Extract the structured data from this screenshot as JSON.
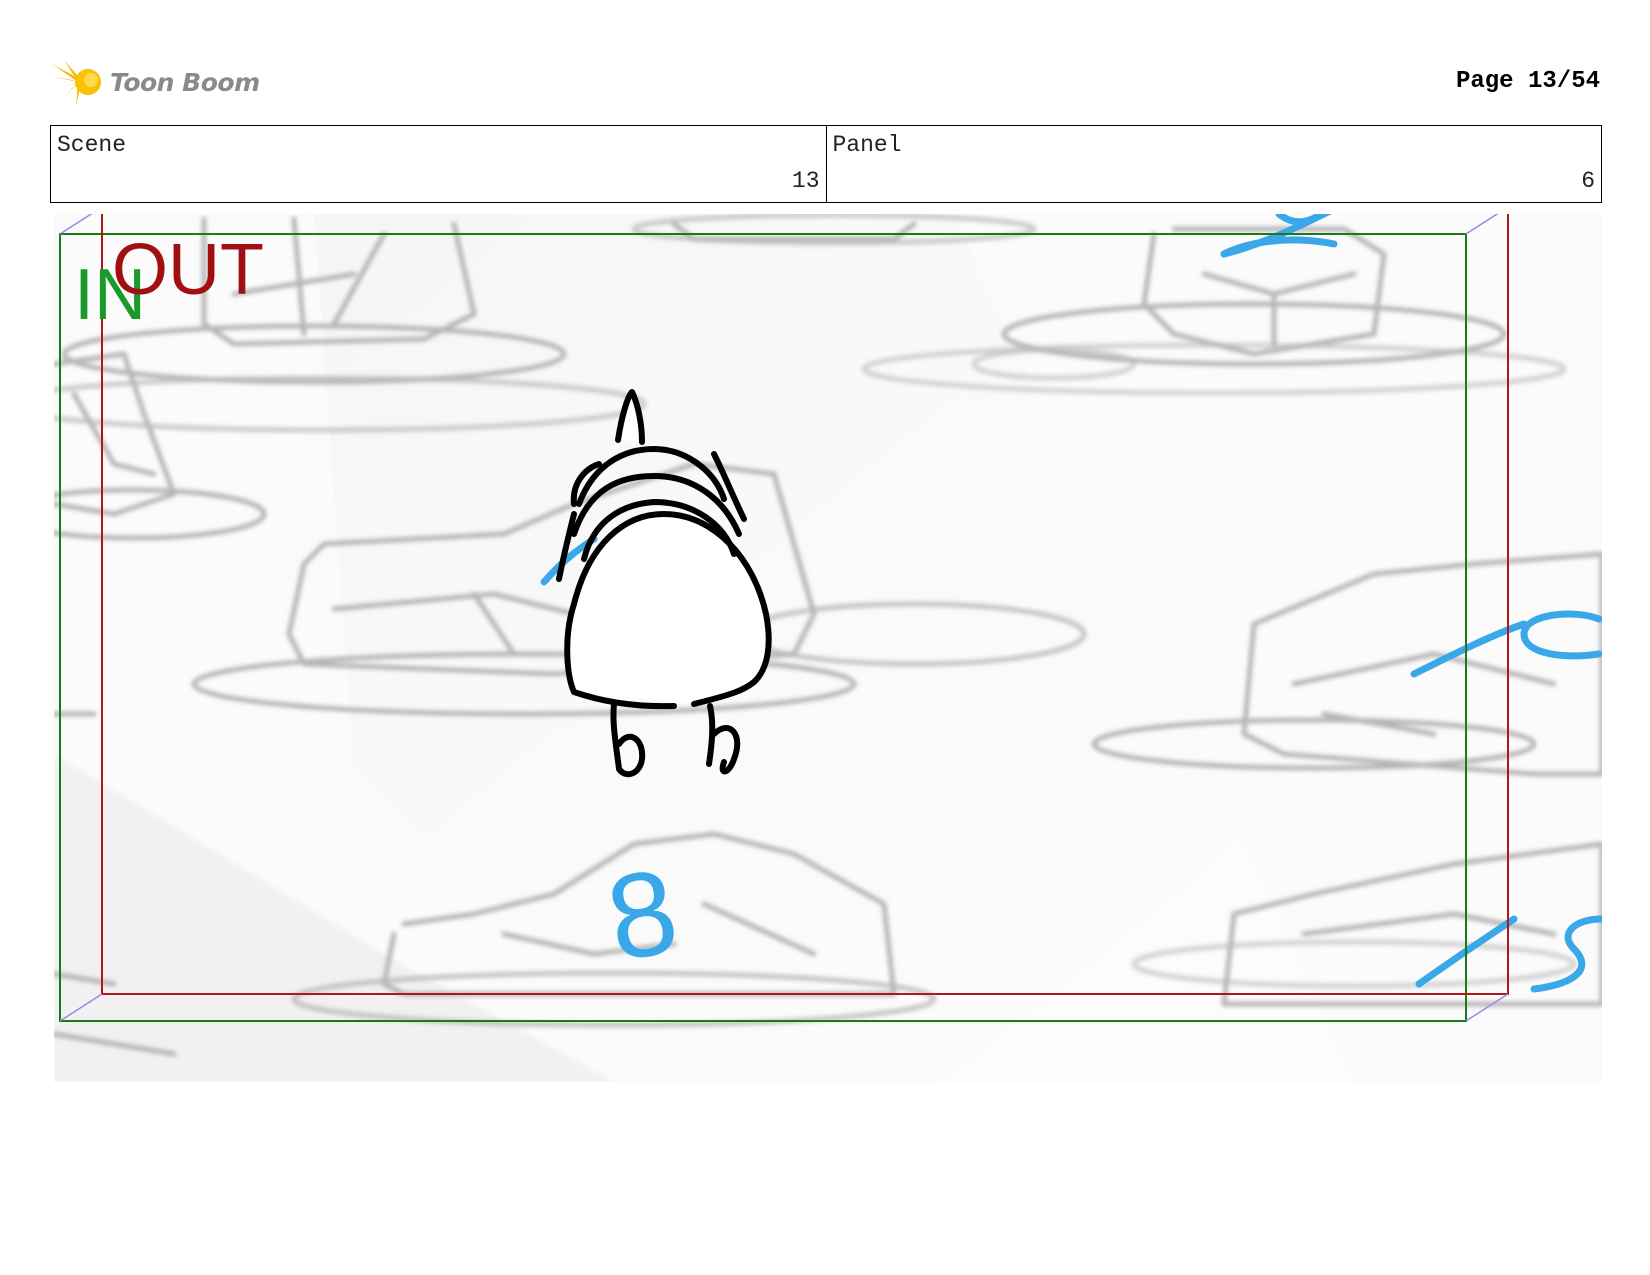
{
  "header": {
    "logo_text": "Toon Boom",
    "page_indicator": "Page 13/54"
  },
  "info": {
    "scene_label": "Scene",
    "scene_value": "13",
    "panel_label": "Panel",
    "panel_value": "6"
  },
  "frame": {
    "in_label": "IN",
    "out_label": "OUT",
    "in_color": "#1a9a2a",
    "out_color": "#a01010"
  },
  "panel_numbers": [
    "8"
  ]
}
